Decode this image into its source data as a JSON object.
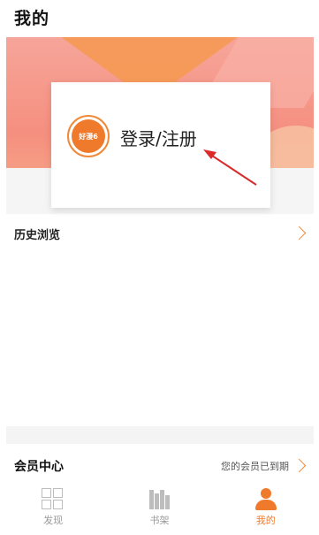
{
  "header": {
    "title": "我的"
  },
  "login_card": {
    "avatar_text": "好漫6",
    "label": "登录/注册"
  },
  "history": {
    "label": "历史浏览"
  },
  "member": {
    "label": "会员中心",
    "status": "您的会员已到期"
  },
  "tabs": [
    {
      "label": "发现",
      "icon": "grid-icon",
      "active": false
    },
    {
      "label": "书架",
      "icon": "bookshelf-icon",
      "active": false
    },
    {
      "label": "我的",
      "icon": "user-icon",
      "active": true
    }
  ],
  "colors": {
    "accent": "#f07a2c",
    "inactive": "#9a9a9a",
    "arrow": "#d92b2b"
  }
}
